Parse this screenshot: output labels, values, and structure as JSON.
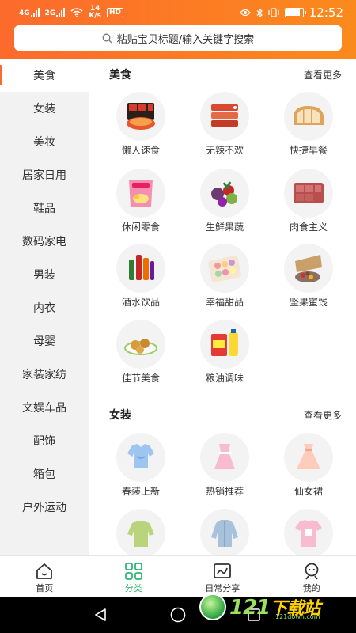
{
  "status_bar": {
    "network_badges": [
      "4G",
      "2G"
    ],
    "speed_value": "14",
    "speed_unit": "K/s",
    "hd_badge": "HD",
    "time": "12:52",
    "battery_level": 0.85
  },
  "search": {
    "placeholder": "粘贴宝贝标题/输入关键字搜索"
  },
  "categories": [
    {
      "label": "美食",
      "active": true
    },
    {
      "label": "女装"
    },
    {
      "label": "美妆"
    },
    {
      "label": "居家日用"
    },
    {
      "label": "鞋品"
    },
    {
      "label": "数码家电"
    },
    {
      "label": "男装"
    },
    {
      "label": "内衣"
    },
    {
      "label": "母婴"
    },
    {
      "label": "家装家纺"
    },
    {
      "label": "文娱车品"
    },
    {
      "label": "配饰"
    },
    {
      "label": "箱包"
    },
    {
      "label": "户外运动"
    }
  ],
  "sections": [
    {
      "title": "美食",
      "more": "查看更多",
      "items": [
        {
          "label": "懒人速食",
          "icon": "instant-food-icon"
        },
        {
          "label": "无辣不欢",
          "icon": "spicy-meat-icon"
        },
        {
          "label": "快捷早餐",
          "icon": "bread-icon"
        },
        {
          "label": "休闲零食",
          "icon": "snack-bag-icon"
        },
        {
          "label": "生鲜果蔬",
          "icon": "fruit-icon"
        },
        {
          "label": "肉食主义",
          "icon": "meat-icon"
        },
        {
          "label": "酒水饮品",
          "icon": "drinks-icon"
        },
        {
          "label": "幸福甜品",
          "icon": "macaron-icon"
        },
        {
          "label": "坚果蜜饯",
          "icon": "nuts-icon"
        },
        {
          "label": "佳节美食",
          "icon": "mooncake-icon"
        },
        {
          "label": "粮油调味",
          "icon": "oil-icon"
        }
      ]
    },
    {
      "title": "女装",
      "more": "查看更多",
      "items": [
        {
          "label": "春装上新",
          "icon": "blouse-icon"
        },
        {
          "label": "热销推荐",
          "icon": "dress-pink-icon"
        },
        {
          "label": "仙女裙",
          "icon": "dress-peach-icon"
        },
        {
          "label": "",
          "icon": "sweater-icon"
        },
        {
          "label": "",
          "icon": "denim-jacket-icon"
        },
        {
          "label": "",
          "icon": "tshirt-icon"
        }
      ]
    }
  ],
  "tabbar": [
    {
      "label": "首页",
      "icon": "home-icon"
    },
    {
      "label": "分类",
      "icon": "grid-icon",
      "active": true
    },
    {
      "label": "日常分享",
      "icon": "share-icon"
    },
    {
      "label": "我的",
      "icon": "user-icon"
    }
  ],
  "watermark": {
    "text": "121",
    "accent": "下载站",
    "sub": "121down.com"
  },
  "colors": {
    "accent_orange": "#fc6a2c",
    "active_green": "#2bb673"
  }
}
